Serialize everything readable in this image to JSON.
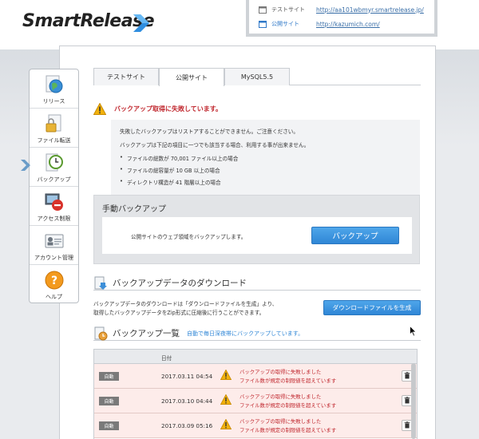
{
  "header": {
    "logo": "SmartRelease",
    "sites": [
      {
        "label": "テストサイト",
        "url": "http://aa101wbmyr.smartrelease.jp/"
      },
      {
        "label": "公開サイト",
        "url": "http://kazumich.com/"
      }
    ]
  },
  "sidebar": {
    "items": [
      {
        "label": "リリース",
        "icon": "globe-icon"
      },
      {
        "label": "ファイル転送",
        "icon": "file-transfer-icon"
      },
      {
        "label": "バックアップ",
        "icon": "backup-clock-icon"
      },
      {
        "label": "アクセス制限",
        "icon": "access-restriction-icon"
      },
      {
        "label": "アカウント管理",
        "icon": "account-card-icon"
      },
      {
        "label": "ヘルプ",
        "icon": "help-icon"
      }
    ]
  },
  "tabs": [
    {
      "label": "テストサイト",
      "active": false
    },
    {
      "label": "公開サイト",
      "active": true
    },
    {
      "label": "MySQL5.5",
      "active": false
    }
  ],
  "alert": {
    "message": "バックアップ取得に失敗しています。"
  },
  "notice": {
    "line1": "失敗したバックアップはリストアすることができません。ご注意ください。",
    "line2": "バックアップは下記の項目に一つでも該当する場合、利用する事が出来ません。",
    "conditions": [
      "ファイルの総数が 70,001 ファイル以上の場合",
      "ファイルの総容量が 10 GB 以上の場合",
      "ディレクトリ構造が 41 階層以上の場合"
    ]
  },
  "manual_backup": {
    "title": "手動バックアップ",
    "description": "公開サイトのウェブ領域をバックアップします。",
    "button": "バックアップ"
  },
  "download": {
    "title": "バックアップデータのダウンロード",
    "desc_line1": "バックアップデータのダウンロードは「ダウンロードファイルを生成」より、",
    "desc_line2": "取得したバックアップデータをZip形式に圧縮後に行うことができます。",
    "button": "ダウンロードファイルを生成"
  },
  "backup_list": {
    "title": "バックアップ一覧",
    "subtitle": "自動で毎日深夜帯にバックアップしています。",
    "column_date": "日付",
    "rows": [
      {
        "type": "自動",
        "date": "2017.03.11 04:54",
        "msg1": "バックアップの取得に失敗しました",
        "msg2": "ファイル数が規定の制限値を超えています"
      },
      {
        "type": "自動",
        "date": "2017.03.10 04:44",
        "msg1": "バックアップの取得に失敗しました",
        "msg2": "ファイル数が規定の制限値を超えています"
      },
      {
        "type": "自動",
        "date": "2017.03.09 05:16",
        "msg1": "バックアップの取得に失敗しました",
        "msg2": "ファイル数が規定の制限値を超えています"
      }
    ]
  },
  "colors": {
    "accent_blue": "#2f86d6",
    "error_red": "#c0262d",
    "row_error_bg": "#fdecea"
  }
}
